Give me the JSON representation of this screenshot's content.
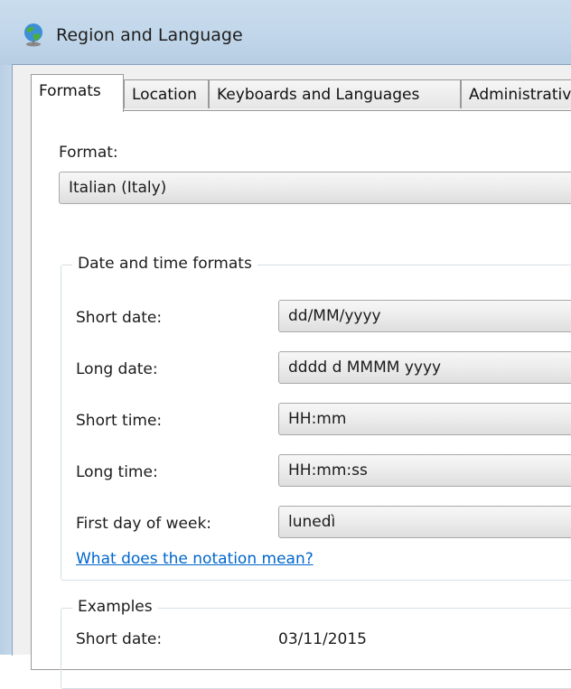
{
  "window": {
    "title": "Region and Language",
    "icon": "globe-icon"
  },
  "tabs": [
    {
      "label": "Formats",
      "active": true
    },
    {
      "label": "Location",
      "active": false
    },
    {
      "label": "Keyboards and Languages",
      "active": false
    },
    {
      "label": "Administrativ",
      "active": false
    }
  ],
  "format": {
    "label": "Format:",
    "value": "Italian (Italy)"
  },
  "date_time": {
    "legend": "Date and time formats",
    "rows": [
      {
        "label": "Short date:",
        "value": "dd/MM/yyyy"
      },
      {
        "label": "Long date:",
        "value": "dddd d MMMM yyyy"
      },
      {
        "label": "Short time:",
        "value": "HH:mm"
      },
      {
        "label": "Long time:",
        "value": "HH:mm:ss"
      },
      {
        "label": "First day of week:",
        "value": "lunedì"
      }
    ],
    "notation_link": "What does the notation mean?"
  },
  "examples": {
    "legend": "Examples",
    "rows": [
      {
        "label": "Short date:",
        "value": "03/11/2015"
      }
    ]
  },
  "colors": {
    "link": "#0066cc",
    "titlebar": "#c2d7ea",
    "panel": "#ffffff"
  }
}
